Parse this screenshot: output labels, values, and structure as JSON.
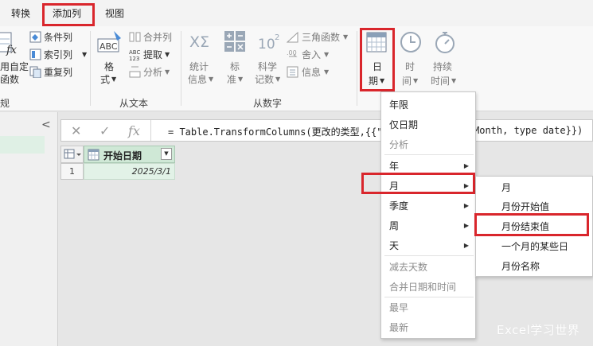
{
  "menu_tabs": {
    "transform": "转换",
    "add_column": "添加列",
    "view": "视图"
  },
  "ribbon": {
    "general": {
      "custom_func_1": "用自定",
      "custom_func_2": "函数",
      "conditional_column": "条件列",
      "index_column": "索引列",
      "duplicate_column": "重复列",
      "group_label": "规"
    },
    "from_text": {
      "format_1": "格",
      "format_2": "式",
      "merge_columns": "合并列",
      "extract": "提取",
      "parse": "分析",
      "group_label": "从文本"
    },
    "from_number": {
      "statistics_1": "统计",
      "statistics_2": "信息",
      "standard_1": "标",
      "standard_2": "准",
      "scientific_1": "科学",
      "scientific_2": "记数",
      "trig": "三角函数",
      "rounding": "舍入",
      "information": "信息",
      "group_label": "从数字"
    },
    "from_date_time": {
      "date_1": "日",
      "date_2": "期",
      "time_1": "时",
      "time_2": "间",
      "duration_1": "持续",
      "duration_2": "时间"
    },
    "icon_text": {
      "abc": "ABC",
      "digits": "123",
      "sigma": "XΣ",
      "power_base": "10",
      "power_exp": "2"
    }
  },
  "left_panel": {
    "collapse_glyph": "<"
  },
  "formula_bar": {
    "cancel_glyph": "✕",
    "confirm_glyph": "✓",
    "fx_glyph": "fx",
    "formula_visible": "= Table.TransformColumns(更改的类型,{{\"开",
    "formula_tail": "Month, type date}})"
  },
  "grid": {
    "column_header": "开始日期",
    "row_number": "1",
    "cell_value": "2025/3/1"
  },
  "date_menu": {
    "items": [
      {
        "label": "年限",
        "enabled": true,
        "submenu": false
      },
      {
        "label": "仅日期",
        "enabled": true,
        "submenu": false
      },
      {
        "label": "分析",
        "enabled": false,
        "submenu": false
      },
      {
        "label": "年",
        "enabled": true,
        "submenu": true
      },
      {
        "label": "月",
        "enabled": true,
        "submenu": true
      },
      {
        "label": "季度",
        "enabled": true,
        "submenu": true
      },
      {
        "label": "周",
        "enabled": true,
        "submenu": true
      },
      {
        "label": "天",
        "enabled": true,
        "submenu": true
      },
      {
        "label": "减去天数",
        "enabled": false,
        "submenu": false
      },
      {
        "label": "合并日期和时间",
        "enabled": false,
        "submenu": false
      },
      {
        "label": "最早",
        "enabled": false,
        "submenu": false
      },
      {
        "label": "最新",
        "enabled": false,
        "submenu": false
      }
    ]
  },
  "month_submenu": {
    "items": [
      "月",
      "月份开始值",
      "月份结束值",
      "一个月的某些日",
      "月份名称"
    ]
  },
  "watermark": "Excel学习世界",
  "colors": {
    "highlight_red": "#d9262c",
    "header_green": "#cfe8d6",
    "cell_green": "#e2f2e7"
  }
}
